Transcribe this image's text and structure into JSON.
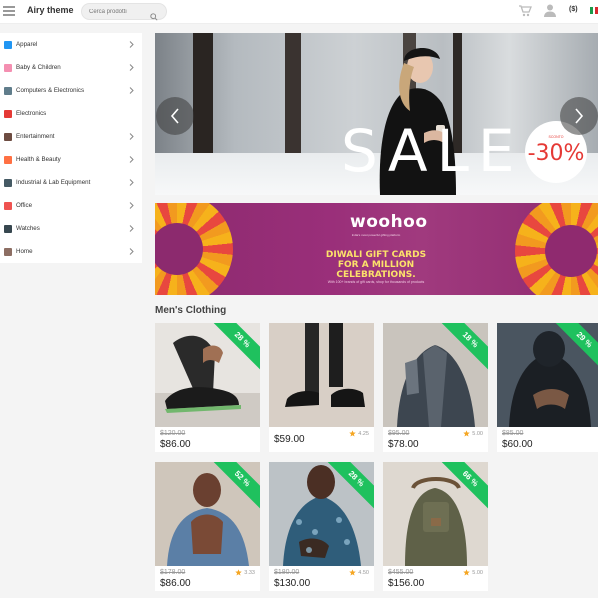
{
  "header": {
    "brand": "Airy theme",
    "search_placeholder": "Cerca prodotti",
    "currency": "($)",
    "icons": [
      "hamburger-icon",
      "search-icon",
      "cart-icon",
      "user-icon"
    ]
  },
  "sidebar": {
    "items": [
      {
        "label": "Apparel",
        "icon": "apparel-icon",
        "color": "#2196f3",
        "has_children": true
      },
      {
        "label": "Baby & Children",
        "icon": "baby-icon",
        "color": "#f48fb1",
        "has_children": true
      },
      {
        "label": "Computers & Electronics",
        "icon": "computer-icon",
        "color": "#607d8b",
        "has_children": true
      },
      {
        "label": "Electronics",
        "icon": "headphones-icon",
        "color": "#e53935",
        "has_children": false
      },
      {
        "label": "Entertainment",
        "icon": "entertainment-icon",
        "color": "#6d4c41",
        "has_children": true
      },
      {
        "label": "Health & Beauty",
        "icon": "health-icon",
        "color": "#ff7043",
        "has_children": true
      },
      {
        "label": "Industrial & Lab Equipment",
        "icon": "industrial-icon",
        "color": "#455a64",
        "has_children": true
      },
      {
        "label": "Office",
        "icon": "office-icon",
        "color": "#ef5350",
        "has_children": true
      },
      {
        "label": "Watches",
        "icon": "watch-icon",
        "color": "#37474f",
        "has_children": true
      },
      {
        "label": "Home",
        "icon": "home-icon",
        "color": "#8d6e63",
        "has_children": true
      }
    ]
  },
  "hero": {
    "headline": "SALE",
    "badge_small": "SCONTO",
    "badge_value": "-30%"
  },
  "promo": {
    "logo": "woohoo",
    "tagline": "India's most powerful gifting platform",
    "line1": "DIWALI GIFT CARDS",
    "line2": "FOR A MILLION CELEBRATIONS.",
    "fine_print": "With 100+ brands of gift cards, shop for thousands of products"
  },
  "section": {
    "title": "Men's Clothing"
  },
  "products": [
    {
      "discount": "28 %",
      "old_price": "$120.00",
      "price": "$86.00",
      "rating": null
    },
    {
      "discount": null,
      "old_price": null,
      "price": "$59.00",
      "rating": "4.25"
    },
    {
      "discount": "18 %",
      "old_price": "$95.00",
      "price": "$78.00",
      "rating": "5.00"
    },
    {
      "discount": "29 %",
      "old_price": "$85.00",
      "price": "$60.00",
      "rating": null
    },
    {
      "discount": "52 %",
      "old_price": "$178.00",
      "price": "$86.00",
      "rating": "3.33"
    },
    {
      "discount": "28 %",
      "old_price": "$180.00",
      "price": "$130.00",
      "rating": "4.50"
    },
    {
      "discount": "66 %",
      "old_price": "$455.00",
      "price": "$156.00",
      "rating": "5.00"
    }
  ],
  "colors": {
    "discount_ribbon": "#1fc15e",
    "rating_star": "#f5a623",
    "sale_badge": "#e53935"
  }
}
